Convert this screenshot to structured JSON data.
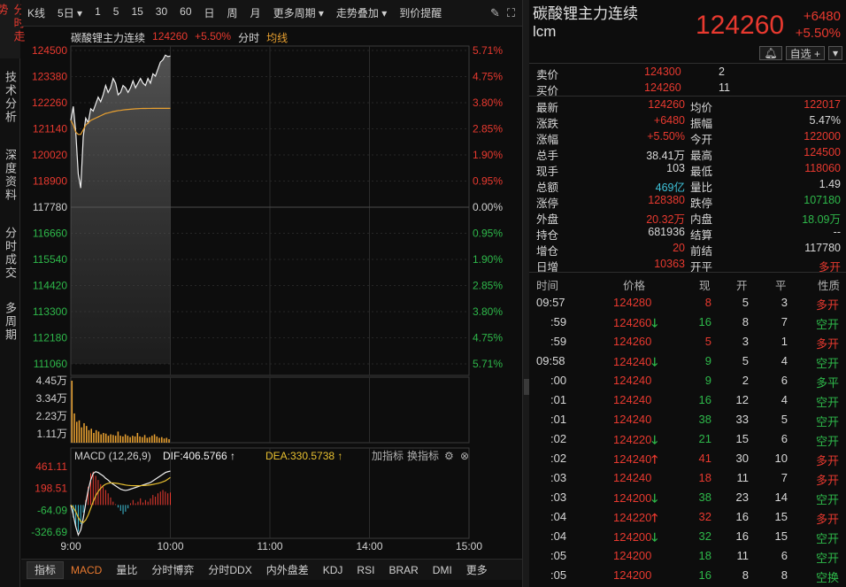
{
  "left_tabs": [
    {
      "label": "分时走势",
      "active": true
    },
    {
      "label": "技术分析",
      "active": false
    },
    {
      "label": "深度资料",
      "active": false
    },
    {
      "label": "分时成交",
      "active": false
    },
    {
      "label": "多周期",
      "active": false
    }
  ],
  "toolbar": {
    "items": [
      "K线",
      "5日 ▾",
      "1",
      "5",
      "15",
      "30",
      "60",
      "日",
      "周",
      "月",
      "更多周期 ▾",
      "走势叠加 ▾",
      "到价提醒"
    ],
    "icons": [
      "pen-icon",
      "fullscreen-icon"
    ]
  },
  "chart_header": {
    "name": "碳酸锂主力连续",
    "price": "124260",
    "pct": "+5.50%",
    "mode": "分时",
    "avg": "均线"
  },
  "chart_data": {
    "type": "line",
    "x_ticks": [
      "9:00",
      "10:00",
      "11:00",
      "14:00",
      "15:00"
    ],
    "price_ticks": [
      "124500",
      "123380",
      "122260",
      "121140",
      "120020",
      "118900",
      "117780",
      "116660",
      "115540",
      "114420",
      "113300",
      "112180",
      "111060"
    ],
    "pct_ticks": [
      "5.71%",
      "4.75%",
      "3.80%",
      "2.85%",
      "1.90%",
      "0.95%",
      "0.00%",
      "0.95%",
      "1.90%",
      "2.85%",
      "3.80%",
      "4.75%",
      "5.71%"
    ],
    "ylim": [
      111060,
      124500
    ],
    "prev_settle": 117780,
    "price_series": [
      121500,
      122100,
      121000,
      119200,
      118600,
      120800,
      121600,
      121400,
      122000,
      121900,
      122200,
      122500,
      122300,
      122600,
      123000,
      122700,
      122900,
      123300,
      123100,
      122600,
      122700,
      123000,
      122900,
      122700,
      122900,
      123200,
      122900,
      123100,
      123300,
      123100,
      123000,
      123300,
      123100,
      123500,
      123400,
      123700,
      124000,
      124100,
      124300,
      124240,
      124260
    ],
    "avg_series": [
      121500,
      121300,
      121000,
      120900,
      120900,
      121100,
      121300,
      121400,
      121500,
      121550,
      121600,
      121650,
      121700,
      121750,
      121800,
      121820,
      121850,
      121880,
      121900,
      121920,
      121930,
      121950,
      121960,
      121970,
      121980,
      121990,
      122000,
      122005,
      122010,
      122012,
      122014,
      122015,
      122016,
      122017,
      122017,
      122017,
      122017,
      122017,
      122017,
      122017,
      122017
    ],
    "volume_ticks": [
      "4.45万",
      "3.34万",
      "2.23万",
      "1.11万"
    ],
    "volume_max": 44500,
    "volume": [
      44500,
      21000,
      15000,
      16000,
      11000,
      14000,
      12000,
      9000,
      10000,
      7000,
      9000,
      8000,
      6000,
      7000,
      6500,
      5000,
      6000,
      5500,
      5000,
      8000,
      5000,
      4500,
      6000,
      5000,
      4000,
      5000,
      4500,
      7000,
      4500,
      4000,
      5500,
      3500,
      4000,
      5000,
      6000,
      4500,
      3500,
      4000,
      3000,
      3500,
      2500
    ],
    "macd": {
      "title": "MACD (12,26,9)",
      "dif_label": "DIF:406.5766",
      "dea_label": "DEA:330.5738",
      "ticks": [
        "461.11",
        "198.51",
        "-64.09",
        "-326.69"
      ],
      "ylim": [
        -400,
        461.11
      ],
      "hist": [
        -20,
        -150,
        -260,
        -320,
        -230,
        -90,
        60,
        220,
        380,
        400,
        350,
        300,
        250,
        220,
        180,
        140,
        90,
        40,
        10,
        -30,
        -70,
        -110,
        -80,
        -40,
        20,
        60,
        20,
        40,
        80,
        30,
        60,
        40,
        80,
        120,
        100,
        140,
        160,
        180,
        160,
        140,
        150
      ],
      "dif": [
        0,
        -120,
        -260,
        -360,
        -300,
        -160,
        20,
        180,
        300,
        380,
        400,
        390,
        370,
        350,
        320,
        300,
        270,
        250,
        230,
        210,
        190,
        180,
        175,
        180,
        190,
        200,
        210,
        220,
        230,
        240,
        250,
        260,
        270,
        290,
        310,
        330,
        350,
        370,
        390,
        400,
        406.58
      ],
      "dea": [
        0,
        -30,
        -80,
        -150,
        -200,
        -210,
        -180,
        -120,
        -40,
        40,
        110,
        160,
        200,
        230,
        250,
        260,
        265,
        265,
        262,
        258,
        252,
        246,
        240,
        236,
        233,
        232,
        231,
        231,
        232,
        233,
        235,
        238,
        242,
        247,
        253,
        260,
        268,
        278,
        290,
        310,
        330.57
      ]
    }
  },
  "macd_actions": [
    "加指标",
    "换指标"
  ],
  "bottom_tabs": [
    "指标",
    "MACD",
    "量比",
    "分时博弈",
    "分时DDX",
    "内外盘差",
    "KDJ",
    "RSI",
    "BRAR",
    "DMI",
    "更多"
  ],
  "quote": {
    "name": "碳酸锂主力连续",
    "code": "lcm",
    "price": "124260",
    "change": "+6480",
    "pct": "+5.50%",
    "self_select": "自选 +",
    "ask": {
      "label": "卖价",
      "price": "124300",
      "vol": "2"
    },
    "bid": {
      "label": "买价",
      "price": "124260",
      "vol": "11"
    },
    "rows": [
      {
        "l1": "最新",
        "v1": "124260",
        "c1": "red",
        "l2": "均价",
        "v2": "122017",
        "c2": "red"
      },
      {
        "l1": "涨跌",
        "v1": "+6480",
        "c1": "red",
        "l2": "振幅",
        "v2": "5.47%",
        "c2": "white"
      },
      {
        "l1": "涨幅",
        "v1": "+5.50%",
        "c1": "red",
        "l2": "今开",
        "v2": "122000",
        "c2": "red"
      },
      {
        "l1": "总手",
        "v1": "38.41万",
        "c1": "white",
        "l2": "最高",
        "v2": "124500",
        "c2": "red"
      },
      {
        "l1": "现手",
        "v1": "103",
        "c1": "white",
        "l2": "最低",
        "v2": "118060",
        "c2": "red"
      },
      {
        "l1": "总额",
        "v1": "469亿",
        "c1": "cyan",
        "l2": "量比",
        "v2": "1.49",
        "c2": "white"
      },
      {
        "l1": "涨停",
        "v1": "128380",
        "c1": "red",
        "l2": "跌停",
        "v2": "107180",
        "c2": "green"
      },
      {
        "l1": "外盘",
        "v1": "20.32万",
        "c1": "red",
        "l2": "内盘",
        "v2": "18.09万",
        "c2": "green"
      },
      {
        "l1": "持仓",
        "v1": "681936",
        "c1": "white",
        "l2": "结算",
        "v2": "--",
        "c2": "white"
      },
      {
        "l1": "增仓",
        "v1": "20",
        "c1": "red",
        "l2": "前结",
        "v2": "117780",
        "c2": "white"
      },
      {
        "l1": "日增",
        "v1": "10363",
        "c1": "red",
        "l2": "开平",
        "v2": "多开",
        "c2": "red"
      }
    ]
  },
  "ticks_header": [
    "时间",
    "价格",
    "现",
    "开",
    "平",
    "性质"
  ],
  "ticks": [
    {
      "t": "09:57",
      "p": "124280",
      "arrow": "",
      "n": "8",
      "nc": "red",
      "o": "5",
      "c": "3",
      "k": "多开",
      "kc": "red"
    },
    {
      "t": ":59",
      "p": "124260",
      "arrow": "down",
      "n": "16",
      "nc": "green",
      "o": "8",
      "c": "7",
      "k": "空开",
      "kc": "green"
    },
    {
      "t": ":59",
      "p": "124260",
      "arrow": "",
      "n": "5",
      "nc": "red",
      "o": "3",
      "c": "1",
      "k": "多开",
      "kc": "red"
    },
    {
      "t": "09:58",
      "p": "124240",
      "arrow": "down",
      "n": "9",
      "nc": "green",
      "o": "5",
      "c": "4",
      "k": "空开",
      "kc": "green"
    },
    {
      "t": ":00",
      "p": "124240",
      "arrow": "",
      "n": "9",
      "nc": "green",
      "o": "2",
      "c": "6",
      "k": "多平",
      "kc": "green"
    },
    {
      "t": ":01",
      "p": "124240",
      "arrow": "",
      "n": "16",
      "nc": "green",
      "o": "12",
      "c": "4",
      "k": "空开",
      "kc": "green"
    },
    {
      "t": ":01",
      "p": "124240",
      "arrow": "",
      "n": "38",
      "nc": "green",
      "o": "33",
      "c": "5",
      "k": "空开",
      "kc": "green"
    },
    {
      "t": ":02",
      "p": "124220",
      "arrow": "down",
      "n": "21",
      "nc": "green",
      "o": "15",
      "c": "6",
      "k": "空开",
      "kc": "green"
    },
    {
      "t": ":02",
      "p": "124240",
      "arrow": "up",
      "n": "41",
      "nc": "red",
      "o": "30",
      "c": "10",
      "k": "多开",
      "kc": "red"
    },
    {
      "t": ":03",
      "p": "124240",
      "arrow": "",
      "n": "18",
      "nc": "red",
      "o": "11",
      "c": "7",
      "k": "多开",
      "kc": "red"
    },
    {
      "t": ":03",
      "p": "124200",
      "arrow": "down",
      "n": "38",
      "nc": "green",
      "o": "23",
      "c": "14",
      "k": "空开",
      "kc": "green"
    },
    {
      "t": ":04",
      "p": "124220",
      "arrow": "up",
      "n": "32",
      "nc": "red",
      "o": "16",
      "c": "15",
      "k": "多开",
      "kc": "red"
    },
    {
      "t": ":04",
      "p": "124200",
      "arrow": "down",
      "n": "32",
      "nc": "green",
      "o": "16",
      "c": "15",
      "k": "空开",
      "kc": "green"
    },
    {
      "t": ":05",
      "p": "124200",
      "arrow": "",
      "n": "18",
      "nc": "green",
      "o": "11",
      "c": "6",
      "k": "空开",
      "kc": "green"
    },
    {
      "t": ":05",
      "p": "124200",
      "arrow": "",
      "n": "16",
      "nc": "green",
      "o": "8",
      "c": "8",
      "k": "空换",
      "kc": "green"
    }
  ]
}
